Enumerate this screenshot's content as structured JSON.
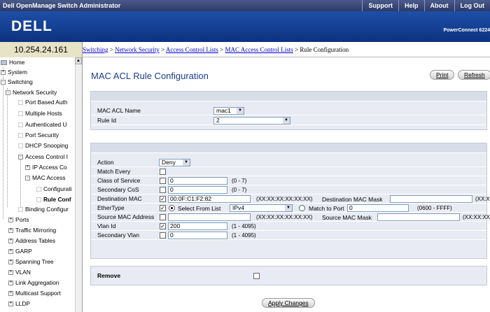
{
  "topbar": {
    "title": "Dell OpenManage Switch Administrator",
    "nav": [
      "Support",
      "Help",
      "About",
      "Log Out"
    ]
  },
  "banner": {
    "logo": "DELL",
    "product": "PowerConnect 6224"
  },
  "ip_address": "10.254.24.161",
  "breadcrumb": {
    "links": [
      "Switching",
      "Network Security",
      "Access Control Lists",
      "MAC Access Control Lists"
    ],
    "separator": ">",
    "current": "Rule Configuration"
  },
  "sidebar": {
    "items": [
      {
        "label": "Home",
        "icon": "computer-icon"
      },
      {
        "label": "System",
        "icon": "plus-expander"
      },
      {
        "label": "Switching",
        "icon": "minus-expander"
      },
      {
        "label": "Network Security",
        "icon": "minus-expander"
      },
      {
        "label": "Port Based Auth"
      },
      {
        "label": "Multiple Hosts"
      },
      {
        "label": "Authenticated U"
      },
      {
        "label": "Port Security"
      },
      {
        "label": "DHCP Snooping"
      },
      {
        "label": "Access Control I",
        "icon": "minus-expander"
      },
      {
        "label": "IP Access Co",
        "icon": "plus-expander"
      },
      {
        "label": "MAC Access",
        "icon": "minus-expander"
      },
      {
        "label": "Configurati"
      },
      {
        "label": "Rule Conf",
        "selected": true
      },
      {
        "label": "Binding Configur"
      },
      {
        "label": "Ports",
        "icon": "plus-expander"
      },
      {
        "label": "Traffic Mirroring",
        "icon": "plus-expander"
      },
      {
        "label": "Address Tables",
        "icon": "plus-expander"
      },
      {
        "label": "GARP",
        "icon": "plus-expander"
      },
      {
        "label": "Spanning Tree",
        "icon": "plus-expander"
      },
      {
        "label": "VLAN",
        "icon": "plus-expander"
      },
      {
        "label": "Link Aggregation",
        "icon": "plus-expander"
      },
      {
        "label": "Multicast Support",
        "icon": "plus-expander"
      },
      {
        "label": "LLDP",
        "icon": "plus-expander"
      }
    ]
  },
  "page": {
    "title": "MAC ACL Rule Configuration",
    "print_label": "Print",
    "refresh_label": "Refresh",
    "apply_label": "Apply Changes"
  },
  "acl_panel": {
    "name_label": "MAC ACL Name",
    "name_value": "mac1",
    "rule_label": "Rule Id",
    "rule_value": "2"
  },
  "rule_panel": {
    "action_label": "Action",
    "action_value": "Deny",
    "match_every_label": "Match Every",
    "match_every_checked": false,
    "cos_label": "Class of Service",
    "cos_checked": false,
    "cos_value": "0",
    "cos_range": "(0 - 7)",
    "sec_cos_label": "Secondary CoS",
    "sec_cos_checked": false,
    "sec_cos_value": "0",
    "sec_cos_range": "(0 - 7)",
    "dest_mac_label": "Destination MAC",
    "dest_mac_checked": true,
    "dest_mac_value": "00:0F:C1:F2:82",
    "dest_mac_format": "(XX:XX:XX:XX:XX:XX)",
    "dest_mask_label": "Destination MAC Mask",
    "dest_mask_value": "",
    "dest_mask_format": "(XX:XX",
    "ethertype_label": "EtherType",
    "ethertype_checked": true,
    "select_from_list_label": "Select From List",
    "select_from_list_selected": true,
    "select_from_list_value": "IPv4",
    "match_to_port_label": "Match to Port",
    "match_to_port_selected": false,
    "match_to_port_value": "0",
    "match_to_port_range": "(0600 - FFFF)",
    "src_mac_label": "Source MAC Address",
    "src_mac_checked": false,
    "src_mac_value": "",
    "src_mac_format": "(XX:XX:XX:XX:XX:XX)",
    "src_mask_label": "Source MAC Mask",
    "src_mask_value": "",
    "src_mask_format": "(XX:XX:XX",
    "vlan_label": "Vlan Id",
    "vlan_checked": true,
    "vlan_value": "200",
    "vlan_range": "(1 - 4095)",
    "sec_vlan_label": "Secondary Vlan",
    "sec_vlan_checked": false,
    "sec_vlan_value": "0",
    "sec_vlan_range": "(1 - 4095)"
  },
  "remove_panel": {
    "label": "Remove",
    "checked": false
  },
  "colors": {
    "title_blue": "#1a3c8c",
    "banner_blue": "#1a4a9c",
    "panel_bg": "#e8ebf3",
    "link_blue": "#0000cc"
  }
}
